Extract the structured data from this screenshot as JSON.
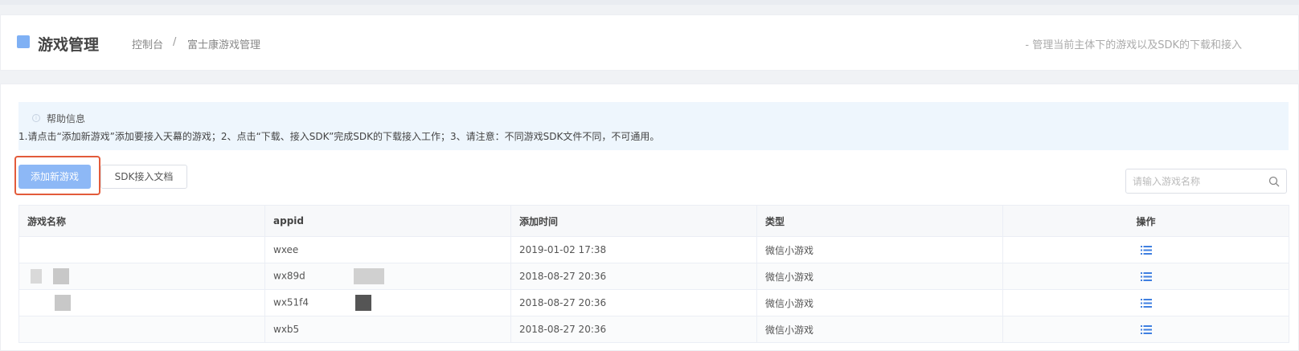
{
  "header": {
    "title": "游戏管理",
    "breadcrumb": [
      "控制台",
      "/",
      "富士康游戏管理"
    ],
    "subtitle": "- 管理当前主体下的游戏以及SDK的下载和接入"
  },
  "help": {
    "title": "帮助信息",
    "text": "1.请点击“添加新游戏”添加要接入天幕的游戏；2、点击“下载、接入SDK”完成SDK的下载接入工作；3、请注意：不同游戏SDK文件不同，不可通用。"
  },
  "toolbar": {
    "add_label": "添加新游戏",
    "doc_label": "SDK接入文档",
    "search_placeholder": "请输入游戏名称"
  },
  "table": {
    "columns": [
      "游戏名称",
      "appid",
      "添加时间",
      "类型",
      "操作"
    ],
    "rows": [
      {
        "name": "",
        "appid": "wxee",
        "time": "2019-01-02 17:38",
        "type": "微信小游戏"
      },
      {
        "name": "",
        "appid": "wx89d",
        "time": "2018-08-27 20:36",
        "type": "微信小游戏"
      },
      {
        "name": "",
        "appid": "wx51f4",
        "time": "2018-08-27 20:36",
        "type": "微信小游戏"
      },
      {
        "name": "",
        "appid": "wxb5",
        "time": "2018-08-27 20:36",
        "type": "微信小游戏"
      }
    ]
  },
  "colors": {
    "accent": "#7fb0f4",
    "button": "#8db8f6",
    "highlight": "#e35b3a",
    "icon": "#3f7fe0"
  },
  "icons": {
    "title": "square-icon",
    "help": "info-icon",
    "search": "search-icon",
    "operation": "list-icon"
  }
}
